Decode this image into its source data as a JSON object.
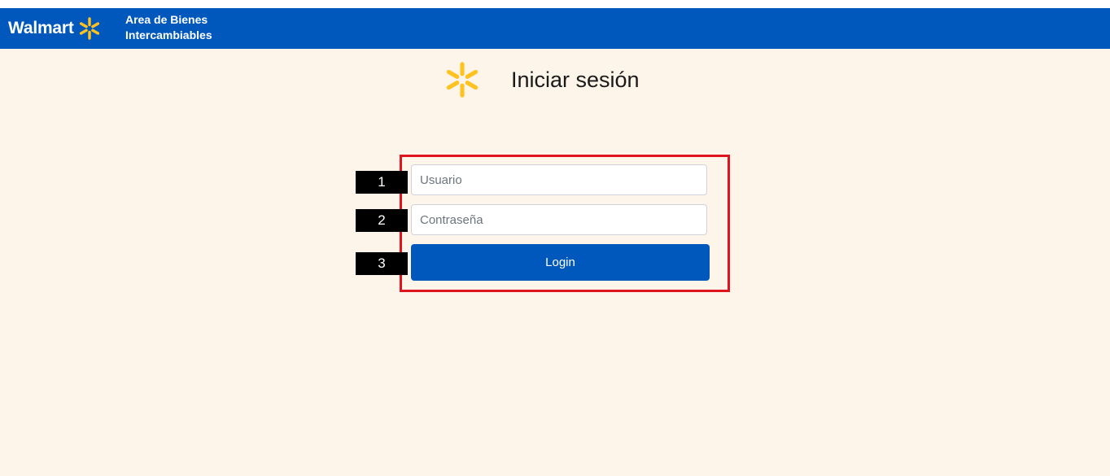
{
  "header": {
    "brand_name": "Walmart",
    "subtitle_line1": "Area de Bienes",
    "subtitle_line2": "Intercambiables",
    "brand_color": "#0058bc",
    "spark_color": "#ffc220"
  },
  "login": {
    "logo_icon": "walmart-spark-icon",
    "title": "Iniciar sesión",
    "username_placeholder": "Usuario",
    "password_placeholder": "Contraseña",
    "login_button_label": "Login",
    "highlight_color": "#e0141e"
  },
  "markers": [
    "1",
    "2",
    "3"
  ]
}
